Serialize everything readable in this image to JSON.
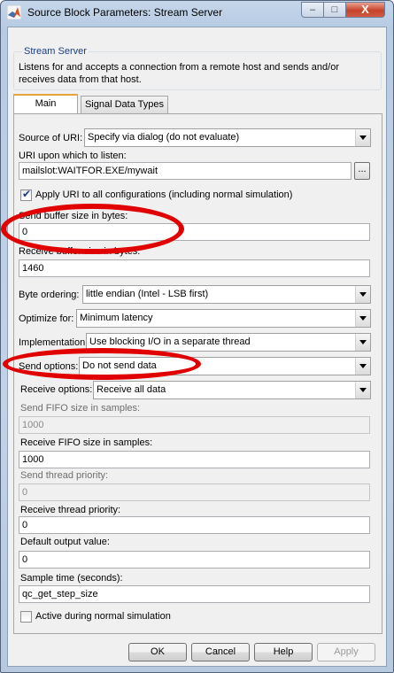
{
  "window": {
    "title": "Source Block Parameters: Stream Server",
    "min_glyph": "–",
    "max_glyph": "□",
    "close_glyph": "X"
  },
  "block": {
    "name": "Stream Server",
    "description": "Listens for and accepts a connection from a remote host and sends and/or receives data from that host."
  },
  "tabs": [
    {
      "label": "Main",
      "selected": true
    },
    {
      "label": "Signal Data Types",
      "selected": false
    }
  ],
  "params": {
    "source_of_uri": {
      "label": "Source of URI:",
      "value": "Specify via dialog (do not evaluate)"
    },
    "uri": {
      "label": "URI upon which to listen:",
      "value": "mailslot:WAITFOR.EXE/mywait",
      "browse_label": "..."
    },
    "apply_uri": {
      "label": "Apply URI to all configurations (including normal simulation)",
      "checked": true
    },
    "send_buffer": {
      "label": "Send buffer size in bytes:",
      "value": "0"
    },
    "receive_buffer": {
      "label": "Receive buffer size in bytes:",
      "value": "1460"
    },
    "byte_ordering": {
      "label": "Byte ordering:",
      "value": "little endian (Intel - LSB first)"
    },
    "optimize_for": {
      "label": "Optimize for:",
      "value": "Minimum latency"
    },
    "implementation": {
      "label": "Implementation:",
      "value": "Use blocking I/O in a separate thread"
    },
    "send_options": {
      "label": "Send options:",
      "value": "Do not send data"
    },
    "receive_options": {
      "label": "Receive options:",
      "value": "Receive all data"
    },
    "send_fifo": {
      "label": "Send FIFO size in samples:",
      "value": "1000",
      "enabled": false
    },
    "receive_fifo": {
      "label": "Receive FIFO size in samples:",
      "value": "1000"
    },
    "send_priority": {
      "label": "Send thread priority:",
      "value": "0",
      "enabled": false
    },
    "receive_priority": {
      "label": "Receive thread priority:",
      "value": "0"
    },
    "default_output": {
      "label": "Default output value:",
      "value": "0"
    },
    "sample_time": {
      "label": "Sample time (seconds):",
      "value": "qc_get_step_size"
    },
    "active_normal": {
      "label": "Active during normal simulation",
      "checked": false
    }
  },
  "buttons": {
    "ok": "OK",
    "cancel": "Cancel",
    "help": "Help",
    "apply": "Apply"
  },
  "colors": {
    "highlight": "#e00000",
    "group_title": "#1a3f84",
    "tab_accent": "#e8a33d"
  }
}
